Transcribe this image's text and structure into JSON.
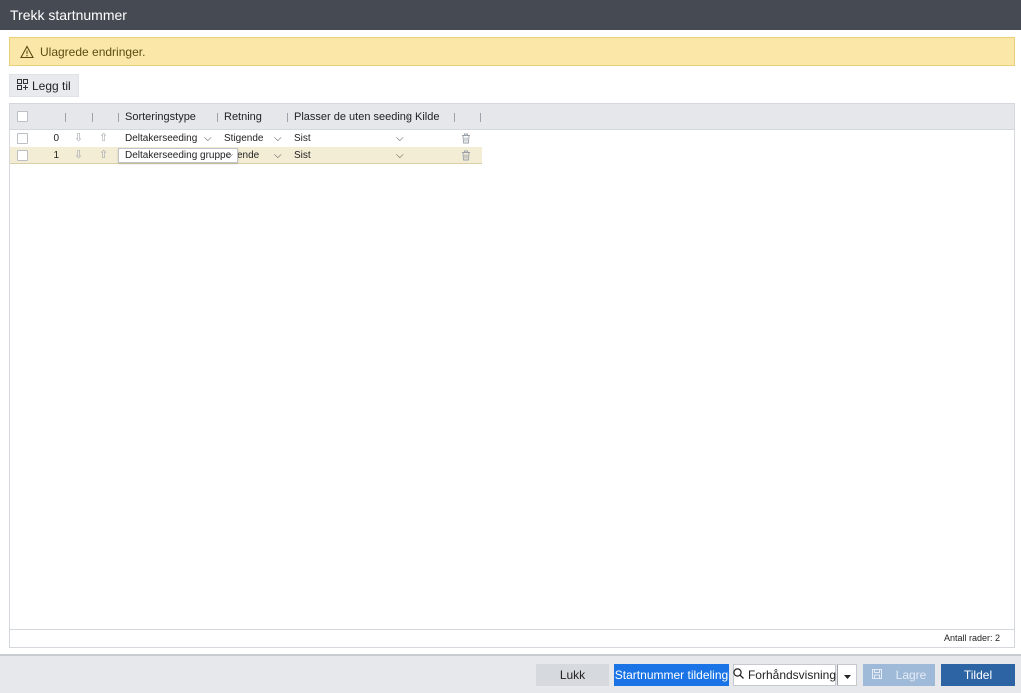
{
  "window": {
    "title": "Trekk startnummer"
  },
  "warning": {
    "text": "Ulagrede endringer.",
    "icon": "warning-triangle-icon"
  },
  "toolbar": {
    "add_label": "Legg til",
    "add_icon": "add-grid-icon"
  },
  "grid": {
    "columns": {
      "sort_type": "Sorteringstype",
      "direction": "Retning",
      "unseeded": "Plasser de uten seeding",
      "source": "Kilde"
    },
    "rows": [
      {
        "index": "0",
        "sort_type": "Deltakerseeding",
        "direction": "Stigende",
        "unseeded": "Sist",
        "source": ""
      },
      {
        "index": "1",
        "sort_type": "Deltakerseeding gruppe",
        "direction": "Stigende",
        "direction_visible": "ende",
        "unseeded": "Sist",
        "source": ""
      }
    ],
    "footer": {
      "row_count": "Antall rader: 2"
    }
  },
  "footer": {
    "close": "Lukk",
    "assign_numbers": "Startnummer tildeling",
    "preview": "Forhåndsvisning",
    "save": "Lagre",
    "assign": "Tildel"
  },
  "colors": {
    "titlebar": "#464b53",
    "warning_bg": "#fbe8a9",
    "primary": "#1a74e6",
    "assign": "#2c64a4",
    "selected_row": "#f3edd5"
  }
}
